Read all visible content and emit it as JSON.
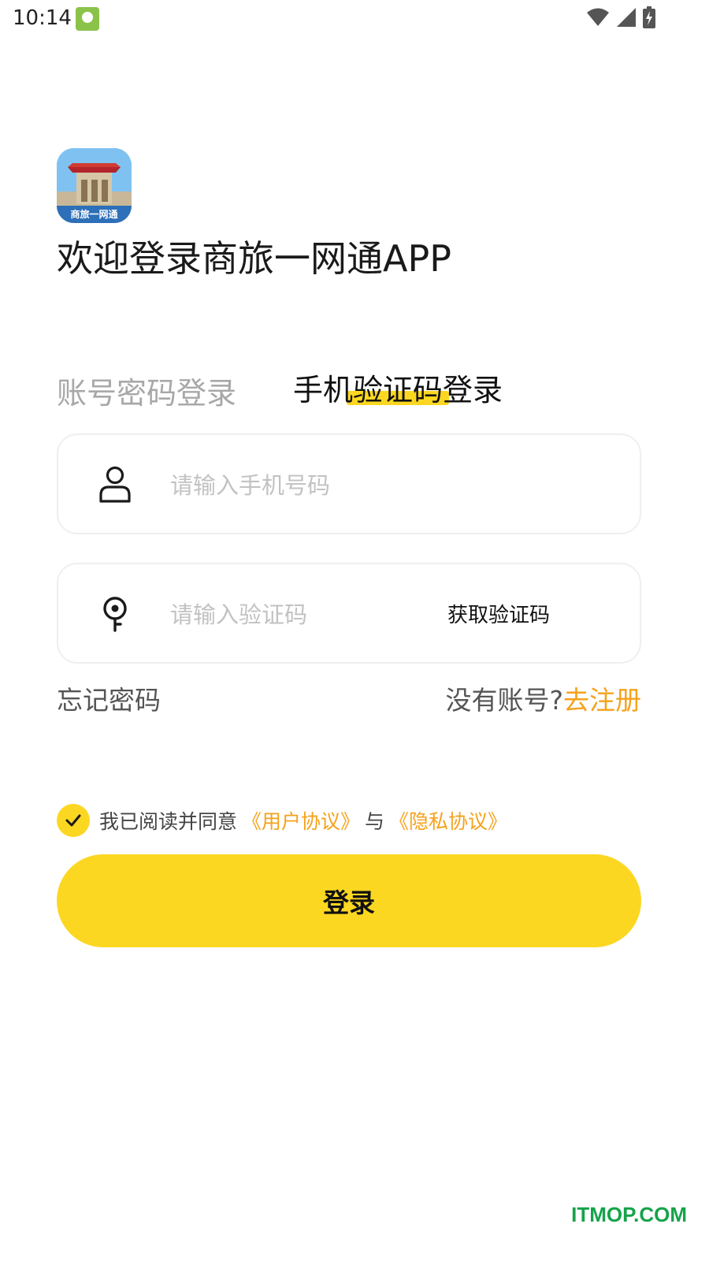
{
  "status_bar": {
    "time": "10:14",
    "icons": [
      "notification-app-icon",
      "wifi-icon",
      "cellular-signal-icon",
      "battery-charging-icon"
    ]
  },
  "header": {
    "welcome_title": "欢迎登录商旅一网通APP",
    "logo_text": "商旅一网通"
  },
  "tabs": [
    {
      "label": "账号密码登录",
      "active": false
    },
    {
      "label": "手机验证码登录",
      "active": true
    }
  ],
  "phone_field": {
    "placeholder": "请输入手机号码",
    "value": "",
    "icon": "user-icon"
  },
  "code_field": {
    "placeholder": "请输入验证码",
    "value": "",
    "icon": "key-icon",
    "get_code_label": "获取验证码"
  },
  "links": {
    "forgot_password": "忘记密码",
    "no_account": "没有账号?",
    "register": "去注册"
  },
  "agreement": {
    "checked": true,
    "prefix": "我已阅读并同意",
    "user_agreement": "《用户协议》",
    "conjunction": "与",
    "privacy_policy": "《隐私协议》"
  },
  "login_button": {
    "label": "登录"
  },
  "watermark": "ITMOP.COM",
  "colors": {
    "accent_yellow": "#fcd721",
    "link_orange": "#f5a21b",
    "placeholder_gray": "#c2c2c2",
    "inactive_tab": "#a8a8a8",
    "watermark_green": "#15a34a"
  }
}
